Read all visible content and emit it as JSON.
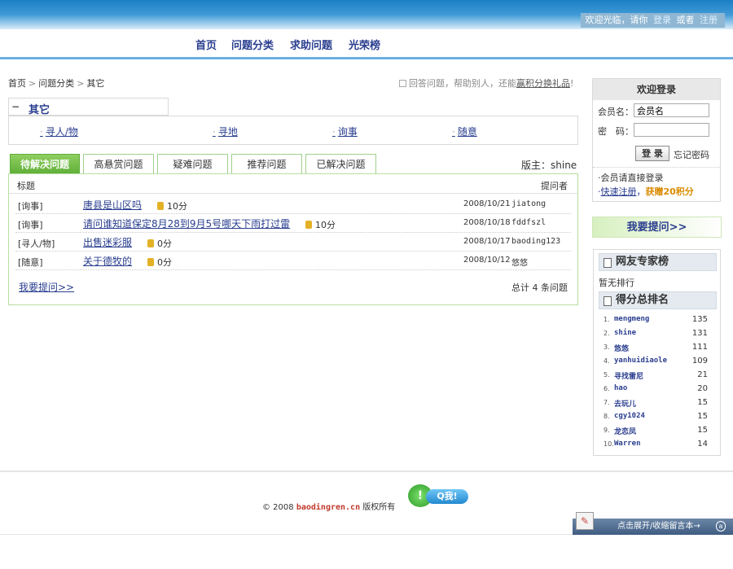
{
  "header": {
    "welcome_text": "欢迎光临，请你",
    "login_link": "登录",
    "or_text": "或者",
    "register_link": "注册"
  },
  "nav": [
    "首页",
    "问题分类",
    "求助问题",
    "光荣榜"
  ],
  "breadcrumb": [
    "首页",
    "问题分类",
    "其它"
  ],
  "tip": {
    "text": "回答问题，帮助别人，还能",
    "link": "赢积分换礼品",
    "suffix": "!"
  },
  "category": {
    "name": "其它",
    "subs": [
      "寻人/物",
      "寻地",
      "询事",
      "随意"
    ]
  },
  "tabs": [
    "待解决问题",
    "高悬赏问题",
    "疑难问题",
    "推荐问题",
    "已解决问题"
  ],
  "moderator": "版主：shine",
  "table": {
    "header_title": "标题",
    "header_asker": "提问者",
    "rows": [
      {
        "category": "[询事]",
        "title": "唐县是山区吗",
        "points": "10分",
        "date": "2008/10/21",
        "user": "jiatong"
      },
      {
        "category": "[询事]",
        "title": "请问谁知道保定8月28到9月5号哪天下雨打过雷",
        "points": "10分",
        "date": "2008/10/18",
        "user": "fddfszl"
      },
      {
        "category": "[寻人/物]",
        "title": "出售迷彩服",
        "points": "0分",
        "date": "2008/10/17",
        "user": "baoding123"
      },
      {
        "category": "[随意]",
        "title": "关于德牧的",
        "points": "0分",
        "date": "2008/10/12",
        "user": "悠悠"
      }
    ],
    "ask_link": "我要提问>>",
    "total": "总计 4 条问题"
  },
  "login": {
    "title": "欢迎登录",
    "user_label": "会员名：",
    "user_value": "会员名",
    "pass_label": "密　码：",
    "button": "登 录",
    "forgot": "忘记密码",
    "note": "·会员请直接登录",
    "reg_prefix": "·",
    "reg_link": "快速注册",
    "reg_sep": "，",
    "bonus": "获赠20积分"
  },
  "ask_button": "我要提问>>",
  "ranking": {
    "experts_title": "网友专家榜",
    "no_rank": "暂无排行",
    "score_title": "得分总排名",
    "rows": [
      {
        "rank": "1.",
        "name": "mengmeng",
        "score": "135"
      },
      {
        "rank": "2.",
        "name": "shine",
        "score": "131"
      },
      {
        "rank": "3.",
        "name": "悠悠",
        "score": "111"
      },
      {
        "rank": "4.",
        "name": "yanhuidiaole",
        "score": "109"
      },
      {
        "rank": "5.",
        "name": "寻找雷尼",
        "score": "21"
      },
      {
        "rank": "6.",
        "name": "hao",
        "score": "20"
      },
      {
        "rank": "7.",
        "name": "去玩儿",
        "score": "15"
      },
      {
        "rank": "8.",
        "name": "cgy1024",
        "score": "15"
      },
      {
        "rank": "9.",
        "name": "龙恋凤",
        "score": "15"
      },
      {
        "rank": "10.",
        "name": "Warren",
        "score": "14"
      }
    ]
  },
  "footer": {
    "copyright_prefix": "© 2008",
    "site": "baodingren.cn",
    "copyright_suffix": "版权所有",
    "qq_label": "Q我!",
    "message_bar": "点击展开/收缩留言本→"
  },
  "colors": {
    "link": "#2a3e8f",
    "tab_active": "#5fae38",
    "top_bar": "#1b7fc4"
  }
}
